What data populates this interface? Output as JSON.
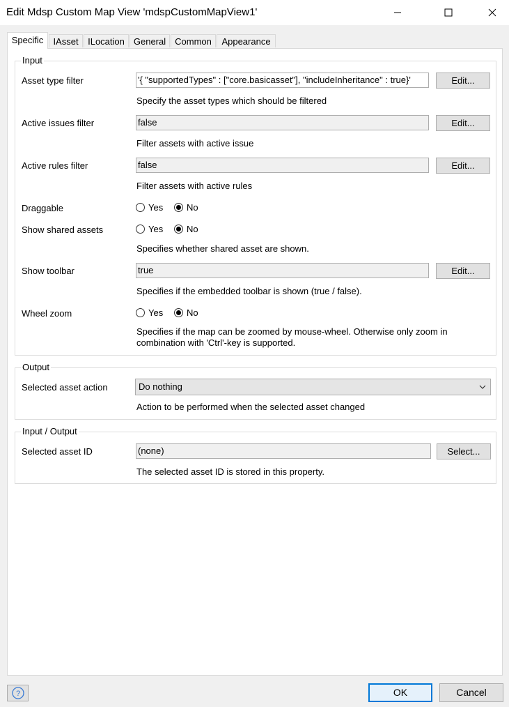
{
  "window": {
    "title": "Edit Mdsp Custom Map View 'mdspCustomMapView1'",
    "minimize_icon": "minimize-icon",
    "maximize_icon": "maximize-icon",
    "close_icon": "close-icon"
  },
  "tabs": [
    {
      "label": "Specific",
      "active": true
    },
    {
      "label": "IAsset",
      "active": false
    },
    {
      "label": "ILocation",
      "active": false
    },
    {
      "label": "General",
      "active": false
    },
    {
      "label": "Common",
      "active": false
    },
    {
      "label": "Appearance",
      "active": false
    }
  ],
  "input_group": {
    "title": "Input",
    "asset_type_filter": {
      "label": "Asset type filter",
      "value": "'{  \"supportedTypes\" : [\"core.basicasset\"],  \"includeInheritance\" : true}'",
      "button": "Edit...",
      "hint": "Specify the asset types which should be filtered"
    },
    "active_issues_filter": {
      "label": "Active issues filter",
      "value": "false",
      "button": "Edit...",
      "hint": "Filter assets with active issue"
    },
    "active_rules_filter": {
      "label": "Active rules filter",
      "value": "false",
      "button": "Edit...",
      "hint": "Filter assets with active rules"
    },
    "draggable": {
      "label": "Draggable",
      "yes": "Yes",
      "no": "No",
      "selected": "No"
    },
    "show_shared_assets": {
      "label": "Show shared assets",
      "yes": "Yes",
      "no": "No",
      "selected": "No",
      "hint": "Specifies whether shared asset are shown."
    },
    "show_toolbar": {
      "label": "Show toolbar",
      "value": "true",
      "button": "Edit...",
      "hint": "Specifies if the embedded toolbar is shown (true / false)."
    },
    "wheel_zoom": {
      "label": "Wheel zoom",
      "yes": "Yes",
      "no": "No",
      "selected": "No",
      "hint_line1": "Specifies if the map can be zoomed by mouse-wheel. Otherwise only zoom in",
      "hint_line2": "combination with 'Ctrl'-key is supported."
    }
  },
  "output_group": {
    "title": "Output",
    "selected_asset_action": {
      "label": "Selected asset action",
      "value": "Do nothing",
      "hint": "Action to be performed when the selected asset changed"
    }
  },
  "io_group": {
    "title": "Input / Output",
    "selected_asset_id": {
      "label": "Selected asset ID",
      "value": "(none)",
      "button": "Select...",
      "hint": "The selected asset ID is stored in this property."
    }
  },
  "footer": {
    "help_icon": "help-icon",
    "ok": "OK",
    "cancel": "Cancel"
  },
  "colors": {
    "accent": "#0078d7",
    "window_bg": "#f0f0f0",
    "panel_bg": "#ffffff"
  }
}
